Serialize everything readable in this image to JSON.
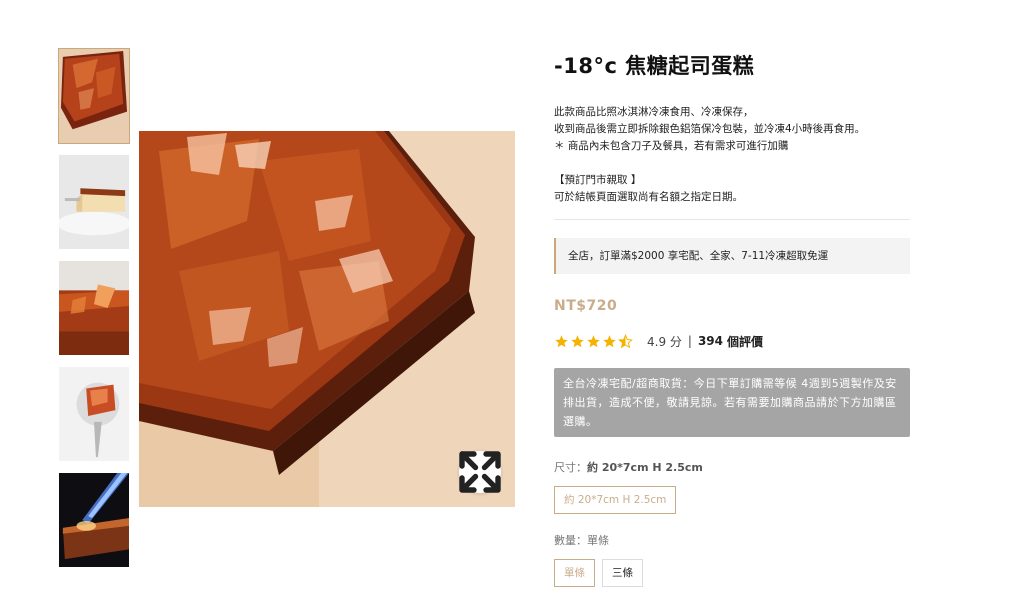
{
  "product": {
    "title": "-18°c 焦糖起司蛋糕",
    "description": [
      "此款商品比照冰淇淋冷凍食用、冷凍保存，",
      "收到商品後需立即拆除銀色鋁箔保冷包裝，並冷凍4小時後再食用。",
      "＊ 商品內未包含刀子及餐具，若有需求可進行加購",
      "",
      "【預訂門市親取 】",
      " 可於結帳頁面選取尚有名額之指定日期。"
    ],
    "notice": "全店，訂單滿$2000 享宅配、全家、7-11冷凍超取免運",
    "price": "NT$720",
    "rating": {
      "score_text": "4.9 分",
      "separator": "|",
      "count": "394",
      "count_unit": "個評價",
      "stars": 4.5
    },
    "shipping_info": "全台冷凍宅配/超商取貨：今日下單訂購需等候 4週到5週製作及安排出貨，造成不便，敬請見諒。若有需要加購商品請於下方加購區選購。",
    "size": {
      "label": "尺寸：",
      "selected": "約 20*7cm H 2.5cm",
      "options": [
        "約 20*7cm H 2.5cm"
      ]
    },
    "quantity": {
      "label": "數量：",
      "selected": "單條",
      "options": [
        "單條",
        "三條"
      ]
    }
  },
  "gallery": {
    "thumbnails": [
      "caramel-top",
      "slice-on-plate",
      "caramel-closeup",
      "spoon-bite",
      "torch-flame"
    ],
    "active_index": 0,
    "zoom_icon": "expand-icon"
  },
  "colors": {
    "accent": "#c9ad8a",
    "shipping_box_bg": "#a5a5a5",
    "star": "#f5b301"
  }
}
